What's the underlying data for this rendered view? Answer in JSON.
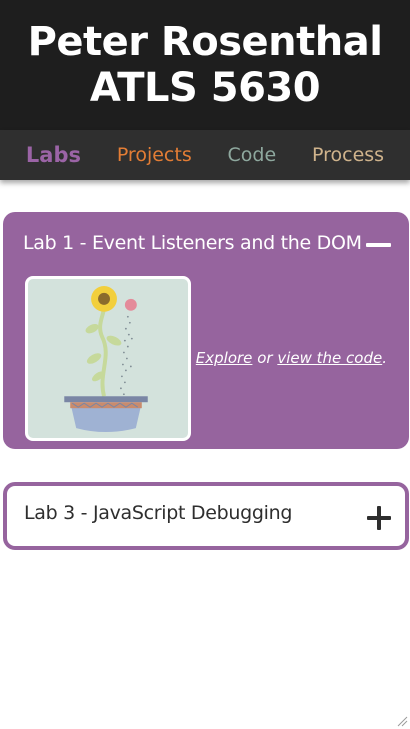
{
  "header": {
    "name": "Peter Rosenthal",
    "course": "ATLS 5630"
  },
  "nav": {
    "items": [
      {
        "label": "Labs",
        "color": "#9b64a6",
        "active": true
      },
      {
        "label": "Projects",
        "color": "#e37d35"
      },
      {
        "label": "Code",
        "color": "#8ea89e"
      },
      {
        "label": "Process",
        "color": "#cfb38c"
      }
    ]
  },
  "labs": [
    {
      "title": "Lab 1 - Event Listeners and the DOM",
      "expanded": true,
      "toggle_icon": "minus-icon",
      "thumbnail_icon": "watering-can-sunflower-icon",
      "explore_label": "Explore",
      "or_text": "or",
      "code_label": "view the code",
      "end_text": "."
    },
    {
      "title": "Lab 3 - JavaScript Debugging",
      "expanded": false,
      "toggle_icon": "plus-icon"
    }
  ],
  "colors": {
    "header_bg": "#1e1e1e",
    "nav_bg": "#2f2f2f",
    "card_purple": "#96649e"
  }
}
